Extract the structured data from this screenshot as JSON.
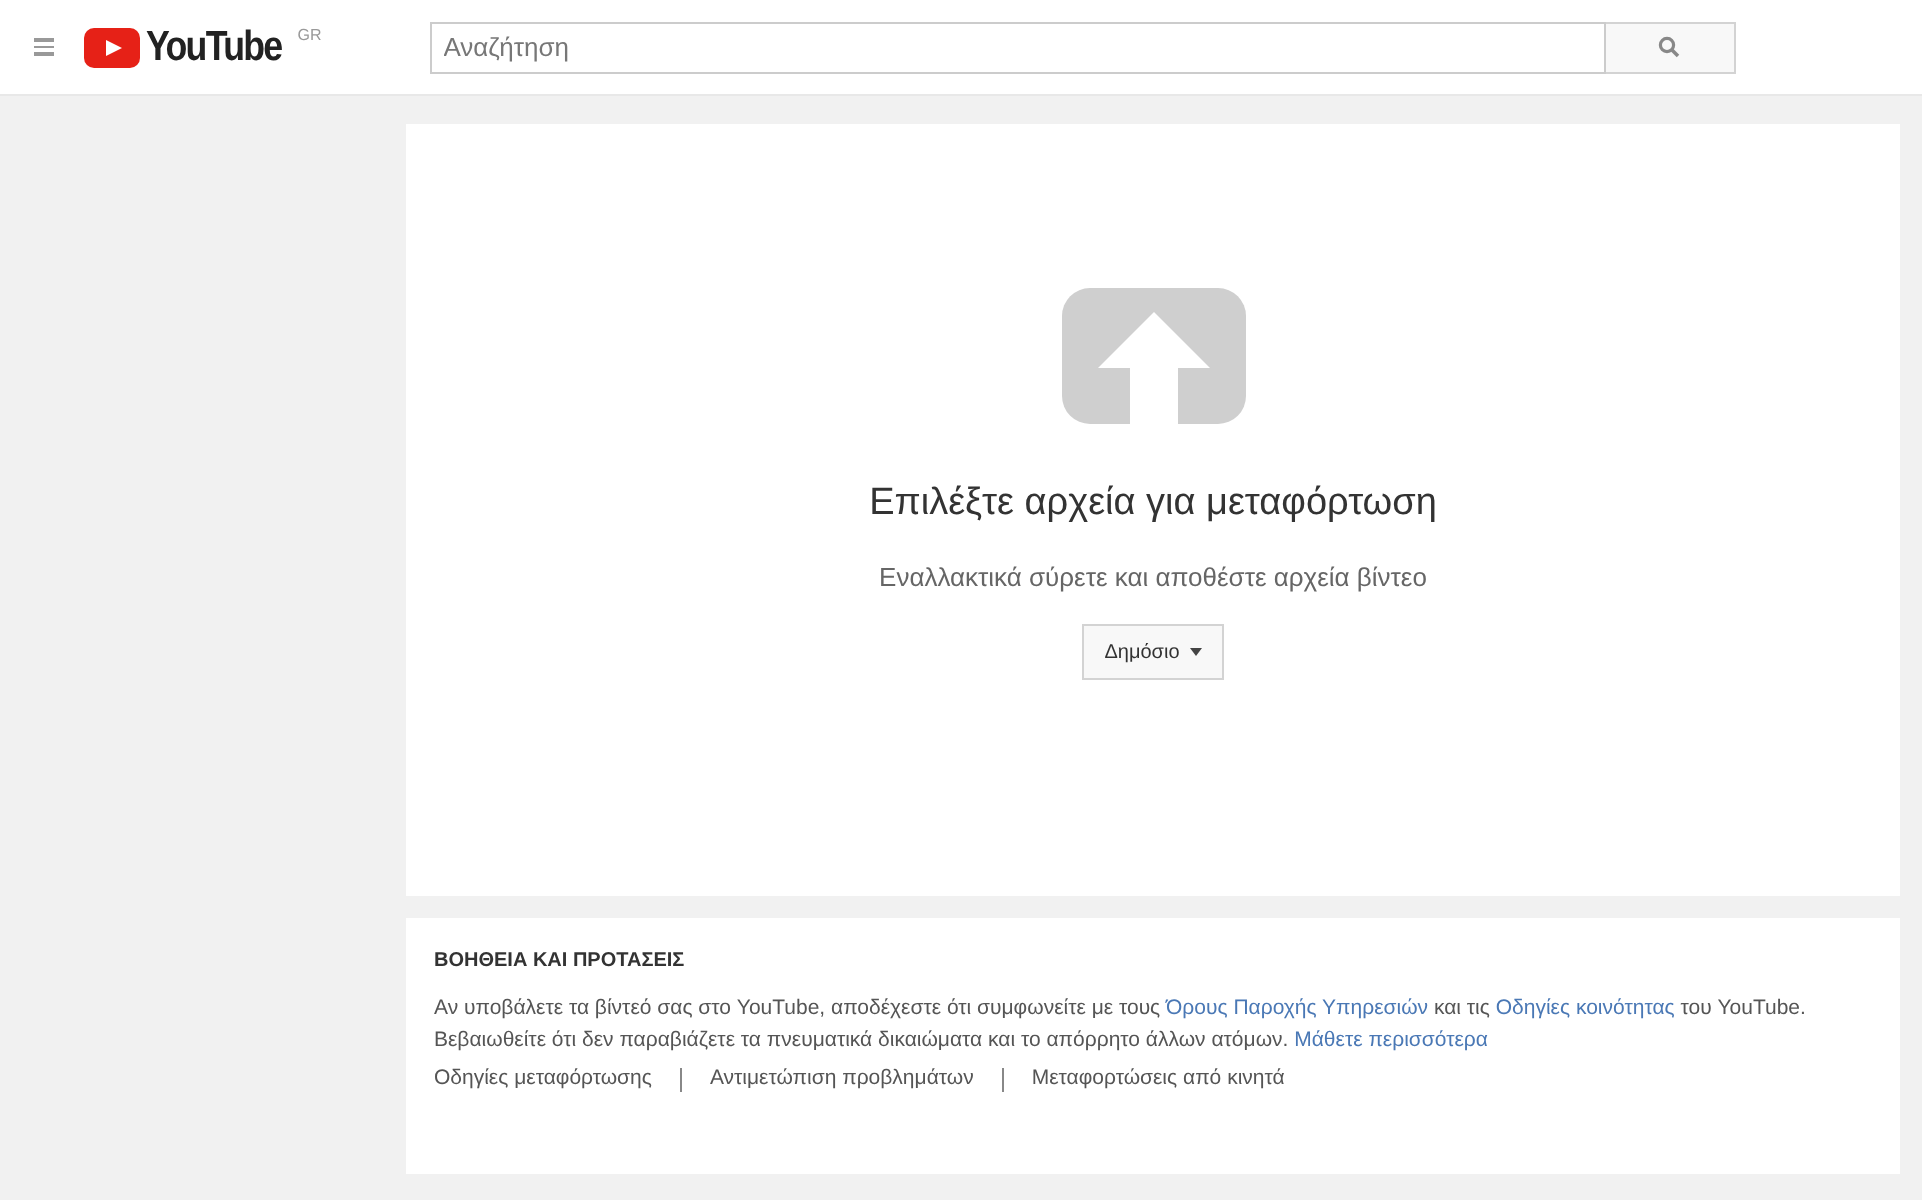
{
  "header": {
    "logo_text": "YouTube",
    "region": "GR",
    "search": {
      "placeholder": "Αναζήτηση"
    }
  },
  "upload": {
    "title": "Επιλέξτε αρχεία για μεταφόρτωση",
    "subtitle": "Εναλλακτικά σύρετε και αποθέστε αρχεία βίντεο",
    "privacy": "Δημόσιο"
  },
  "help": {
    "heading": "ΒΟΗΘΕΙΑ ΚΑΙ ΠΡΟΤΑΣΕΙΣ",
    "paragraphs": [
      [
        {
          "kind": "text",
          "text": "Αν υποβάλετε τα βίντεό σας στο YouTube, αποδέχεστε ότι συμφωνείτε με τους "
        },
        {
          "kind": "link",
          "text": "Όρους Παροχής Υπηρεσιών"
        },
        {
          "kind": "text",
          "text": " και τις "
        },
        {
          "kind": "link",
          "text": "Οδηγίες κοινότητας"
        },
        {
          "kind": "text",
          "text": " του YouTube."
        }
      ],
      [
        {
          "kind": "text",
          "text": "Βεβαιωθείτε ότι δεν παραβιάζετε τα πνευματικά δικαιώματα και το απόρρητο άλλων ατόμων. "
        },
        {
          "kind": "link",
          "text": "Μάθετε περισσότερα"
        }
      ]
    ],
    "links": [
      "Οδηγίες μεταφόρτωσης",
      "Αντιμετώπιση προβλημάτων",
      "Μεταφορτώσεις από κινητά"
    ]
  }
}
